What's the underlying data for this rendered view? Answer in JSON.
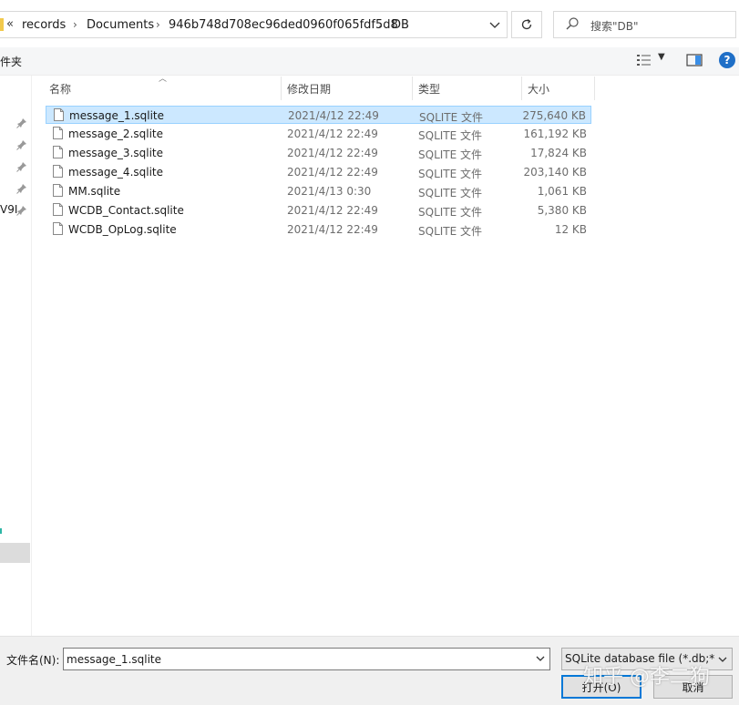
{
  "address": {
    "overflow": "«",
    "crumbs": [
      "records",
      "Documents",
      "946b748d708ec96ded0960f065fdf5d8",
      "DB"
    ]
  },
  "search": {
    "placeholder": "搜索\"DB\""
  },
  "toolbar": {
    "partial_label": "件夹"
  },
  "nav": {
    "partial_item": "V9I"
  },
  "columns": {
    "name": "名称",
    "date": "修改日期",
    "type": "类型",
    "size": "大小"
  },
  "files": [
    {
      "name": "message_1.sqlite",
      "date": "2021/4/12 22:49",
      "type": "SQLITE 文件",
      "size": "275,640 KB",
      "selected": true
    },
    {
      "name": "message_2.sqlite",
      "date": "2021/4/12 22:49",
      "type": "SQLITE 文件",
      "size": "161,192 KB"
    },
    {
      "name": "message_3.sqlite",
      "date": "2021/4/12 22:49",
      "type": "SQLITE 文件",
      "size": "17,824 KB"
    },
    {
      "name": "message_4.sqlite",
      "date": "2021/4/12 22:49",
      "type": "SQLITE 文件",
      "size": "203,140 KB"
    },
    {
      "name": "MM.sqlite",
      "date": "2021/4/13 0:30",
      "type": "SQLITE 文件",
      "size": "1,061 KB"
    },
    {
      "name": "WCDB_Contact.sqlite",
      "date": "2021/4/12 22:49",
      "type": "SQLITE 文件",
      "size": "5,380 KB"
    },
    {
      "name": "WCDB_OpLog.sqlite",
      "date": "2021/4/12 22:49",
      "type": "SQLITE 文件",
      "size": "12 KB"
    }
  ],
  "bottom": {
    "filename_label": "文件名(N):",
    "filename_value": "message_1.sqlite",
    "filetype": "SQLite database file (*.db;*.c",
    "open_label": "打开(O)",
    "cancel_label": "取消"
  },
  "watermark": "知乎 @李二狗",
  "colors": {
    "selection": "#cce8ff",
    "selection_border": "#99d1ff",
    "accent": "#0078d7",
    "help": "#1f6fc7"
  },
  "icons": [
    "chevron-down-icon",
    "refresh-icon",
    "search-icon",
    "view-options-icon",
    "preview-pane-icon",
    "help-icon",
    "pin-icon",
    "file-icon"
  ]
}
